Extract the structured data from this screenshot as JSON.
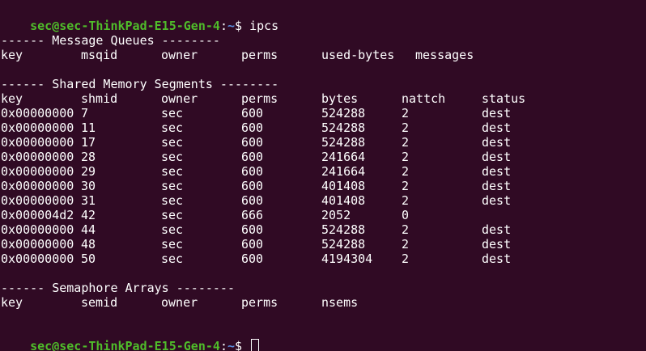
{
  "prompt": {
    "user_host": "sec@sec-ThinkPad-E15-Gen-4",
    "colon": ":",
    "path": "~",
    "dollar": "$ "
  },
  "command": "ipcs",
  "message_queues": {
    "header": "------ Message Queues --------",
    "columns": [
      "key",
      "msqid",
      "owner",
      "perms",
      "used-bytes",
      "messages"
    ]
  },
  "shared_memory": {
    "header": "------ Shared Memory Segments --------",
    "columns": [
      "key",
      "shmid",
      "owner",
      "perms",
      "bytes",
      "nattch",
      "status"
    ],
    "rows": [
      [
        "0x00000000",
        "7",
        "sec",
        "600",
        "524288",
        "2",
        "dest"
      ],
      [
        "0x00000000",
        "11",
        "sec",
        "600",
        "524288",
        "2",
        "dest"
      ],
      [
        "0x00000000",
        "17",
        "sec",
        "600",
        "524288",
        "2",
        "dest"
      ],
      [
        "0x00000000",
        "28",
        "sec",
        "600",
        "241664",
        "2",
        "dest"
      ],
      [
        "0x00000000",
        "29",
        "sec",
        "600",
        "241664",
        "2",
        "dest"
      ],
      [
        "0x00000000",
        "30",
        "sec",
        "600",
        "401408",
        "2",
        "dest"
      ],
      [
        "0x00000000",
        "31",
        "sec",
        "600",
        "401408",
        "2",
        "dest"
      ],
      [
        "0x000004d2",
        "42",
        "sec",
        "666",
        "2052",
        "0",
        ""
      ],
      [
        "0x00000000",
        "44",
        "sec",
        "600",
        "524288",
        "2",
        "dest"
      ],
      [
        "0x00000000",
        "48",
        "sec",
        "600",
        "524288",
        "2",
        "dest"
      ],
      [
        "0x00000000",
        "50",
        "sec",
        "600",
        "4194304",
        "2",
        "dest"
      ]
    ]
  },
  "semaphores": {
    "header": "------ Semaphore Arrays --------",
    "columns": [
      "key",
      "semid",
      "owner",
      "perms",
      "nsems"
    ]
  },
  "colors": {
    "background": "#300a24",
    "prompt_user": "#4fbd2a",
    "prompt_path": "#5a8fe0",
    "text": "#ffffff"
  }
}
